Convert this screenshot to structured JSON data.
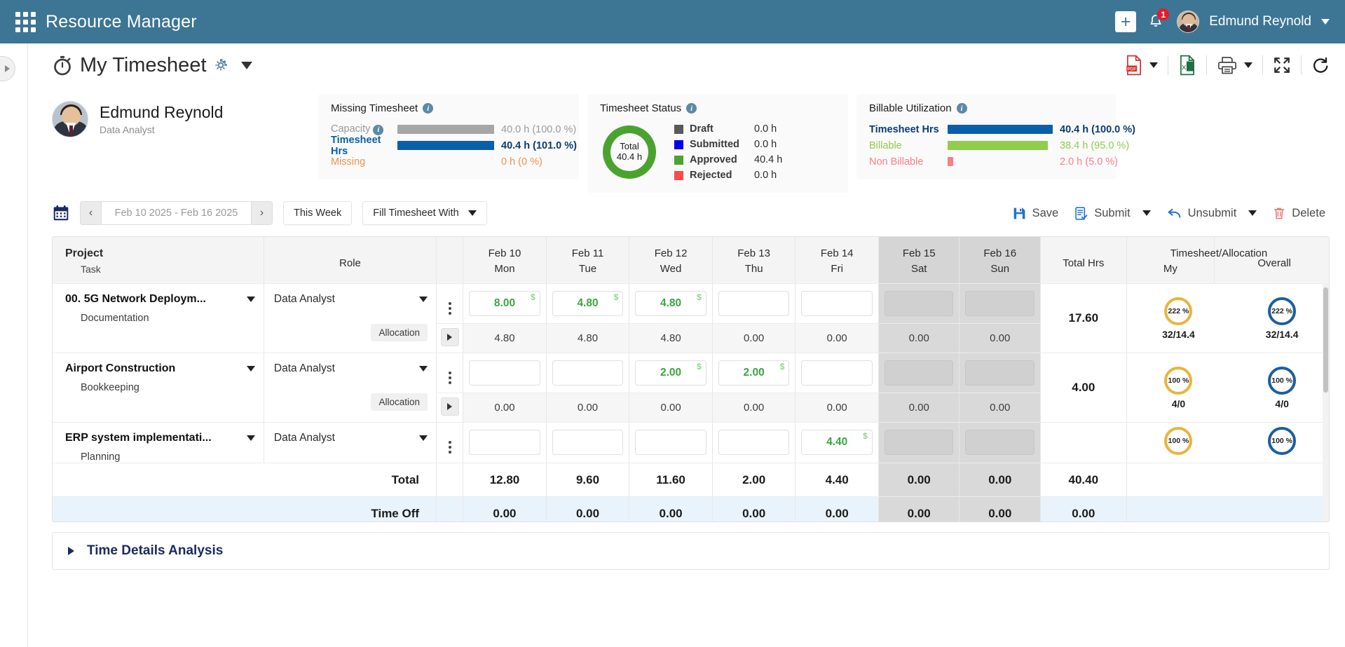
{
  "topbar": {
    "app_title": "Resource Manager",
    "add_icon": "plus-icon",
    "notification_icon": "bell-icon",
    "notification_count": "1",
    "user_name": "Edmund Reynold",
    "user_caret": "chevron-down-icon"
  },
  "page": {
    "title": "My Timesheet",
    "title_icon": "stopwatch-icon",
    "settings_icon": "gear-icon",
    "title_caret": "caret-down-icon",
    "actions": [
      {
        "name": "export-pdf",
        "icon": "pdf-icon",
        "has_caret": true
      },
      {
        "name": "export-excel",
        "icon": "excel-icon",
        "has_caret": false
      },
      {
        "name": "print",
        "icon": "printer-icon",
        "has_caret": true
      },
      {
        "name": "fullscreen",
        "icon": "expand-icon",
        "has_caret": false
      },
      {
        "name": "refresh",
        "icon": "refresh-icon",
        "has_caret": false
      }
    ]
  },
  "person": {
    "name": "Edmund Reynold",
    "role": "Data Analyst"
  },
  "cards": {
    "missing": {
      "title": "Missing Timesheet",
      "rows": [
        {
          "label": "Capacity",
          "value": "40.0 h (100.0 %)",
          "pct": 100,
          "color": "#a6a6a6",
          "label_color": "#9a9a9a",
          "value_color": "#9a9a9a",
          "has_info": true,
          "bold": false
        },
        {
          "label": "Timesheet Hrs",
          "value": "40.4 h (101.0 %)",
          "pct": 100,
          "color": "#0b5ea8",
          "label_color": "#0b5ea8",
          "value_color": "#0b3c6e",
          "has_info": false,
          "bold": true
        },
        {
          "label": "Missing",
          "value": "0 h (0 %)",
          "pct": 0,
          "color": "#f6a04d",
          "label_color": "#f0914a",
          "value_color": "#f0914a",
          "has_info": false,
          "bold": false
        }
      ]
    },
    "status": {
      "title": "Timesheet Status",
      "donut_label": "Total",
      "donut_value": "40.4 h",
      "donut_color": "#4aa32f",
      "legend": [
        {
          "name": "Draft",
          "value": "0.0 h",
          "color": "#595959"
        },
        {
          "name": "Submitted",
          "value": "0.0 h",
          "color": "#0000ee"
        },
        {
          "name": "Approved",
          "value": "40.4 h",
          "color": "#4aa32f"
        },
        {
          "name": "Rejected",
          "value": "0.0 h",
          "color": "#fb4c4c"
        }
      ]
    },
    "billable": {
      "title": "Billable Utilization",
      "rows": [
        {
          "label": "Timesheet Hrs",
          "value": "40.4 h (100.0 %)",
          "pct": 100,
          "color": "#0b5ea8",
          "label_color": "#0b3c6e",
          "value_color": "#0b3c6e",
          "has_info": false,
          "bold": true
        },
        {
          "label": "Billable",
          "value": "38.4 h (95.0 %)",
          "pct": 95,
          "color": "#90cc4e",
          "label_color": "#90cc4e",
          "value_color": "#90cc4e",
          "has_info": false,
          "bold": false
        },
        {
          "label": "Non Billable",
          "value": "2.0 h (5.0 %)",
          "pct": 5,
          "color": "#fb7f7f",
          "label_color": "#fb7f7f",
          "value_color": "#fb7f7f",
          "has_info": false,
          "bold": false
        }
      ]
    }
  },
  "toolbar": {
    "calendar_icon": "calendar-icon",
    "prev_label": "‹",
    "next_label": "›",
    "date_range": "Feb 10 2025 - Feb 16 2025",
    "this_week_label": "This Week",
    "fill_timesheet_label": "Fill Timesheet With",
    "save_label": "Save",
    "submit_label": "Submit",
    "unsubmit_label": "Unsubmit",
    "delete_label": "Delete"
  },
  "table": {
    "headers": {
      "project": "Project",
      "task": "Task",
      "role": "Role",
      "total_hrs": "Total Hrs",
      "alloc_group": "Timesheet/Allocation",
      "alloc_my": "My",
      "alloc_overall": "Overall"
    },
    "days": [
      {
        "date": "Feb 10",
        "dow": "Mon",
        "weekend": false
      },
      {
        "date": "Feb 11",
        "dow": "Tue",
        "weekend": false
      },
      {
        "date": "Feb 12",
        "dow": "Wed",
        "weekend": false
      },
      {
        "date": "Feb 13",
        "dow": "Thu",
        "weekend": false
      },
      {
        "date": "Feb 14",
        "dow": "Fri",
        "weekend": false
      },
      {
        "date": "Feb 15",
        "dow": "Sat",
        "weekend": true
      },
      {
        "date": "Feb 16",
        "dow": "Sun",
        "weekend": true
      }
    ],
    "allocation_pill": "Allocation",
    "rows": [
      {
        "project": "00. 5G Network Deploym...",
        "task": "Documentation",
        "role": "Data Analyst",
        "hours": [
          "8.00",
          "4.80",
          "4.80",
          "",
          "",
          "",
          ""
        ],
        "billable_flags": [
          true,
          true,
          true,
          false,
          false,
          false,
          false
        ],
        "allocation": [
          "4.80",
          "4.80",
          "4.80",
          "0.00",
          "0.00",
          "0.00",
          "0.00"
        ],
        "total": "17.60",
        "my": {
          "pct": "222 %",
          "sub": "32/14.4"
        },
        "overall": {
          "pct": "222 %",
          "sub": "32/14.4"
        }
      },
      {
        "project": "Airport Construction",
        "task": "Bookkeeping",
        "role": "Data Analyst",
        "hours": [
          "",
          "",
          "2.00",
          "2.00",
          "",
          "",
          ""
        ],
        "billable_flags": [
          false,
          false,
          true,
          true,
          false,
          false,
          false
        ],
        "allocation": [
          "0.00",
          "0.00",
          "0.00",
          "0.00",
          "0.00",
          "0.00",
          "0.00"
        ],
        "total": "4.00",
        "my": {
          "pct": "100 %",
          "sub": "4/0"
        },
        "overall": {
          "pct": "100 %",
          "sub": "4/0"
        }
      },
      {
        "project": "ERP system implementati...",
        "task": "Planning",
        "role": "Data Analyst",
        "hours": [
          "",
          "",
          "",
          "",
          "4.40",
          "",
          ""
        ],
        "billable_flags": [
          false,
          false,
          false,
          false,
          true,
          false,
          false
        ],
        "allocation": [
          "",
          "",
          "",
          "",
          "",
          "",
          ""
        ],
        "total": "",
        "my": {
          "pct": "100 %",
          "sub": ""
        },
        "overall": {
          "pct": "100 %",
          "sub": ""
        }
      }
    ],
    "total_row": {
      "label": "Total",
      "values": [
        "12.80",
        "9.60",
        "11.60",
        "2.00",
        "4.40",
        "0.00",
        "0.00"
      ],
      "total": "40.40"
    },
    "timeoff_row": {
      "label": "Time Off",
      "values": [
        "0.00",
        "0.00",
        "0.00",
        "0.00",
        "0.00",
        "0.00",
        "0.00"
      ],
      "total": "0.00"
    }
  },
  "footer": {
    "time_details_label": "Time Details Analysis",
    "expand_icon": "caret-right-icon"
  },
  "colors": {
    "brand": "#3d7595",
    "accent_blue": "#0b5ea8",
    "green": "#4aa32f",
    "orange": "#e8b53c",
    "badge_red": "#e8192c"
  }
}
